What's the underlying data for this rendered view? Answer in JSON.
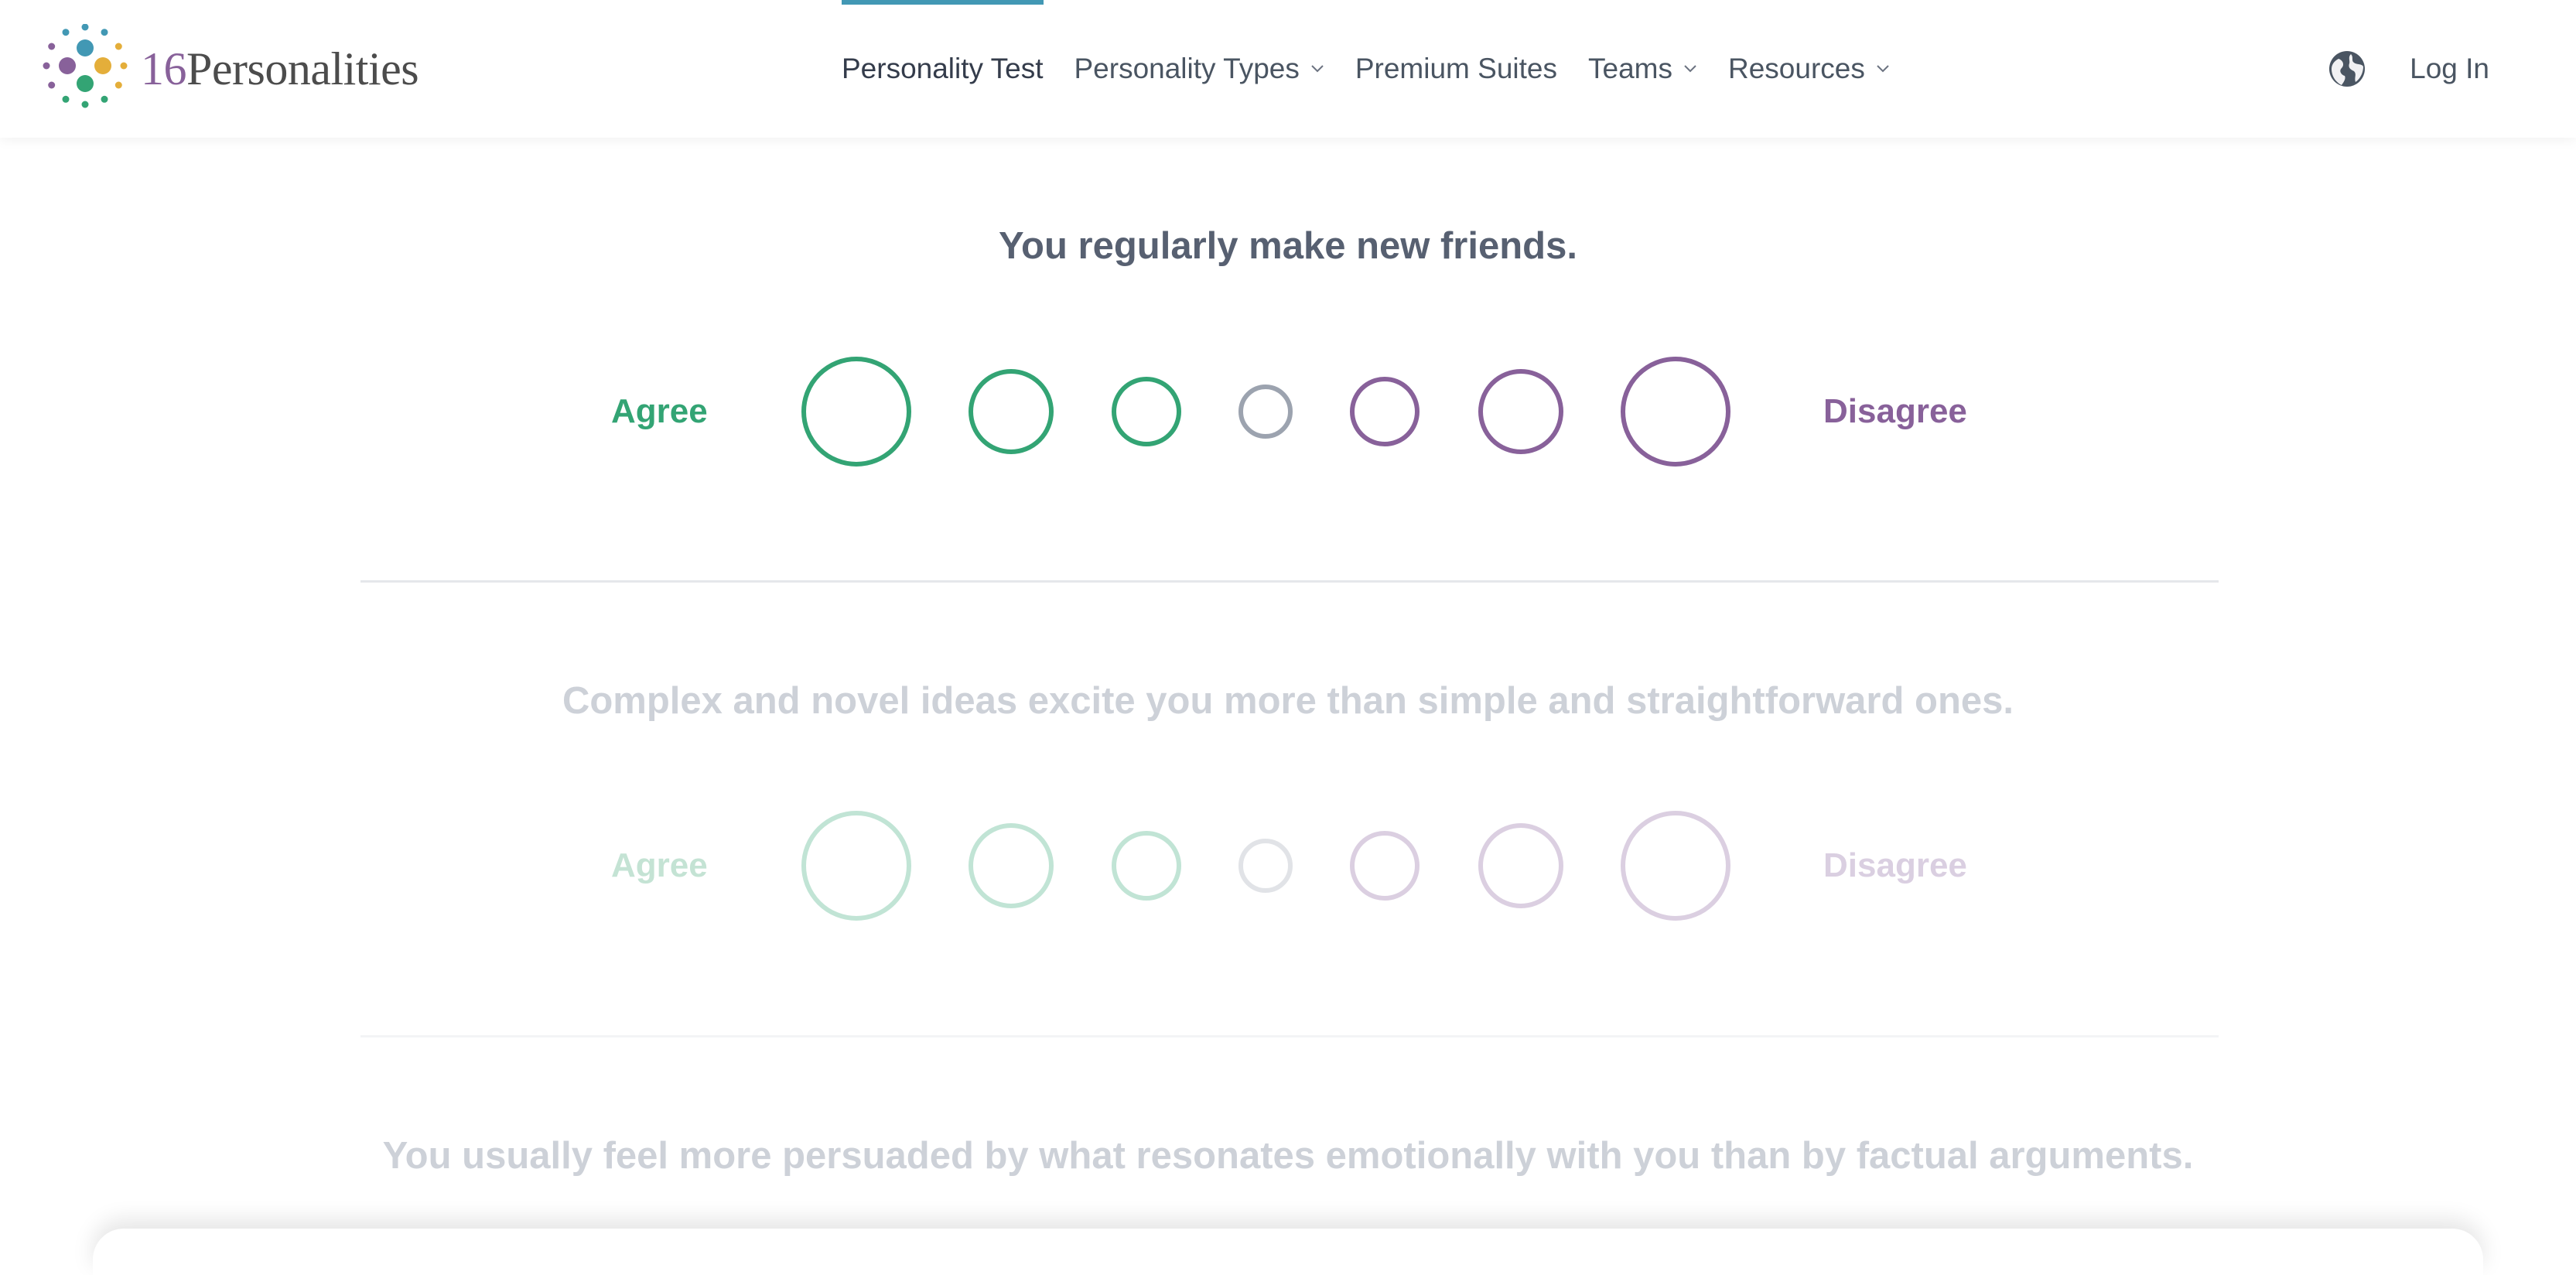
{
  "brand": {
    "number": "16",
    "name": "Personalities"
  },
  "nav": {
    "items": [
      {
        "label": "Personality Test",
        "active": true,
        "dropdown": false
      },
      {
        "label": "Personality Types",
        "active": false,
        "dropdown": true
      },
      {
        "label": "Premium Suites",
        "active": false,
        "dropdown": false
      },
      {
        "label": "Teams",
        "active": false,
        "dropdown": true
      },
      {
        "label": "Resources",
        "active": false,
        "dropdown": true
      }
    ],
    "language_icon": "globe-icon",
    "login_label": "Log In"
  },
  "colors": {
    "agree": "#33a474",
    "disagree": "#88619a",
    "neutral": "#9ca3af",
    "accent": "#4298b4"
  },
  "questions": [
    {
      "text": "You regularly make new friends.",
      "agree_label": "Agree",
      "disagree_label": "Disagree",
      "state": "active"
    },
    {
      "text": "Complex and novel ideas excite you more than simple and straightforward ones.",
      "agree_label": "Agree",
      "disagree_label": "Disagree",
      "state": "inactive"
    },
    {
      "text": "You usually feel more persuaded by what resonates emotionally with you than by factual arguments.",
      "state": "inactive"
    }
  ]
}
